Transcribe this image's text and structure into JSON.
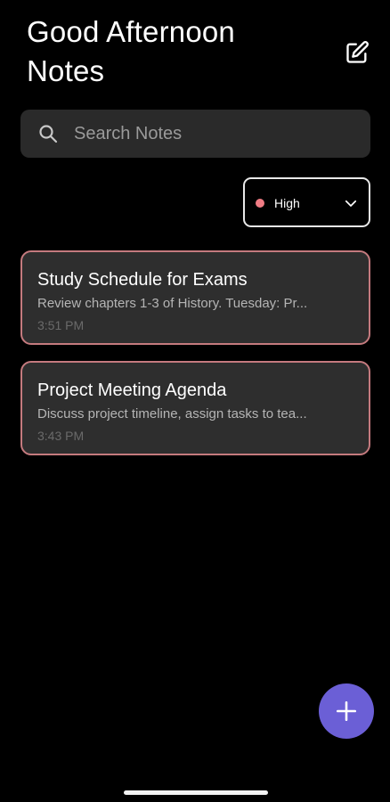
{
  "header": {
    "title": "Good Afternoon Notes",
    "edit_icon": "edit-note-icon"
  },
  "search": {
    "placeholder": "Search Notes",
    "value": "",
    "icon": "search-icon"
  },
  "filter": {
    "selected": "High",
    "dot_color": "#f07c84",
    "chevron_icon": "chevron-down-icon"
  },
  "notes": [
    {
      "title": "Study Schedule for Exams",
      "preview": "Review chapters 1-3 of History. Tuesday: Pr...",
      "time": "3:51 PM"
    },
    {
      "title": "Project Meeting Agenda",
      "preview": "Discuss project timeline, assign tasks to tea...",
      "time": "3:43 PM"
    }
  ],
  "fab": {
    "icon": "plus-icon",
    "color": "#6b5fd6"
  },
  "colors": {
    "background": "#000000",
    "card": "#2e2e2e",
    "card_border": "#c47a7e",
    "search_bg": "#2a2a2a"
  }
}
